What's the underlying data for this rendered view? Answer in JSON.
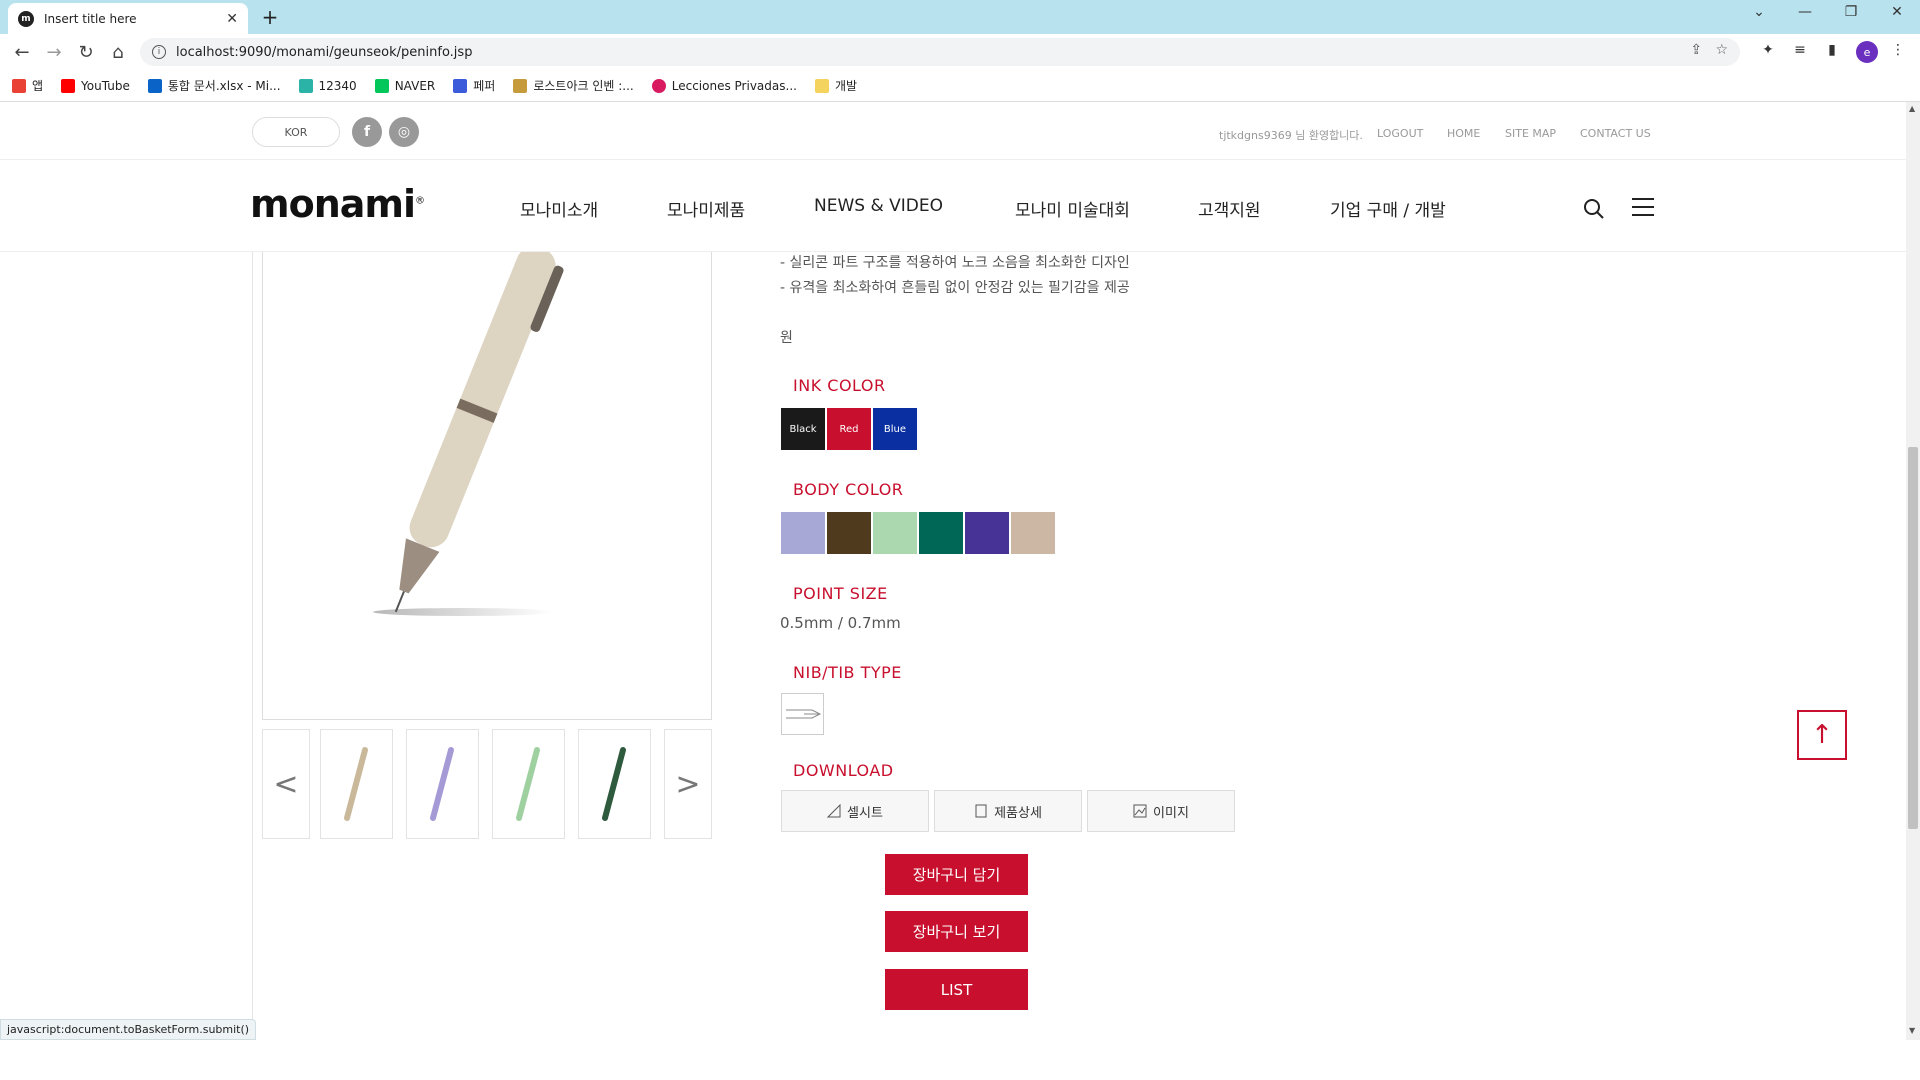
{
  "browser": {
    "tab_title": "Insert title here",
    "tab_favicon": "m",
    "url": "localhost:9090/monami/geunseok/peninfo.jsp",
    "profile_initial": "e",
    "bookmarks": [
      {
        "label": "앱",
        "color": "#e94235"
      },
      {
        "label": "YouTube",
        "color": "#ff0000"
      },
      {
        "label": "통합 문서.xlsx - Mi...",
        "color": "#0a64c8"
      },
      {
        "label": "12340",
        "color": "#2ab3a6"
      },
      {
        "label": "NAVER",
        "color": "#03c75a"
      },
      {
        "label": "페퍼",
        "color": "#3b5bdb"
      },
      {
        "label": "로스트아크 인벤 :...",
        "color": "#c59b3c"
      },
      {
        "label": "Lecciones Privadas...",
        "color": "#d81b60"
      },
      {
        "label": "개발",
        "color": "#f4d35e"
      }
    ],
    "status_text": "javascript:document.toBasketForm.submit()"
  },
  "site": {
    "lang_label": "KOR",
    "social": [
      "f",
      "◎"
    ],
    "greeting": "tjtkdgns9369 님 환영합니다.",
    "util_links": [
      "LOGOUT",
      "HOME",
      "SITE MAP",
      "CONTACT US"
    ],
    "logo": "monami",
    "menu": [
      "모나미소개",
      "모나미제품",
      "NEWS & VIDEO",
      "모나미 미술대회",
      "고객지원",
      "기업 구매 / 개발"
    ]
  },
  "product": {
    "desc_lines": [
      "- 실리콘 파트 구조를 적용하여 노크 소음을 최소화한 디자인",
      "- 유격을 최소화하여 흔들림 없이 안정감 있는 필기감을 제공"
    ],
    "price_unit": "원",
    "ink_title": "INK COLOR",
    "inks": [
      {
        "label": "Black",
        "color": "#1a1a1a"
      },
      {
        "label": "Red",
        "color": "#c8102e"
      },
      {
        "label": "Blue",
        "color": "#0a2fa0"
      }
    ],
    "body_title": "BODY COLOR",
    "body_colors": [
      "#a8a8d6",
      "#4f3a1e",
      "#acd8b0",
      "#006656",
      "#473296",
      "#cbb7a4"
    ],
    "point_title": "POINT SIZE",
    "point_value": "0.5mm / 0.7mm",
    "nib_title": "NIB/TIB TYPE",
    "download_title": "DOWNLOAD",
    "downloads": [
      "셀시트",
      "제품상세",
      "이미지"
    ],
    "actions": [
      "장바구니 담기",
      "장바구니 보기",
      "LIST"
    ],
    "thumb_colors": [
      "#c9b89a",
      "#a59ad6",
      "#9fd0a0",
      "#2e5a3e"
    ]
  },
  "colors": {
    "brand": "#c8102e"
  }
}
